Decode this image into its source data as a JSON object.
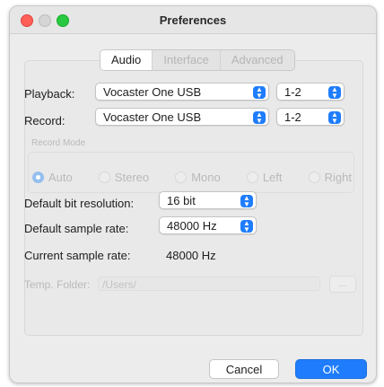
{
  "window": {
    "title": "Preferences"
  },
  "tabs": [
    {
      "label": "Audio",
      "active": true
    },
    {
      "label": "Interface",
      "active": false
    },
    {
      "label": "Advanced",
      "active": false
    }
  ],
  "playback": {
    "label": "Playback:",
    "device": "Vocaster One USB",
    "channels": "1-2"
  },
  "record": {
    "label": "Record:",
    "device": "Vocaster One USB",
    "channels": "1-2"
  },
  "record_mode": {
    "label": "Record Mode",
    "options": [
      {
        "label": "Auto",
        "selected": true
      },
      {
        "label": "Stereo",
        "selected": false
      },
      {
        "label": "Mono",
        "selected": false
      },
      {
        "label": "Left",
        "selected": false
      },
      {
        "label": "Right",
        "selected": false
      }
    ]
  },
  "bit_resolution": {
    "label": "Default bit resolution:",
    "value": "16 bit"
  },
  "sample_rate": {
    "label": "Default sample rate:",
    "value": "48000 Hz"
  },
  "current_rate": {
    "label": "Current sample rate:",
    "value": "48000 Hz"
  },
  "temp_folder": {
    "label": "Temp. Folder:",
    "value": "/Users/",
    "browse_label": "..."
  },
  "buttons": {
    "cancel": "Cancel",
    "ok": "OK"
  },
  "colors": {
    "accent": "#1f7dfd",
    "close": "#fe5f57",
    "maximize": "#28c840"
  }
}
